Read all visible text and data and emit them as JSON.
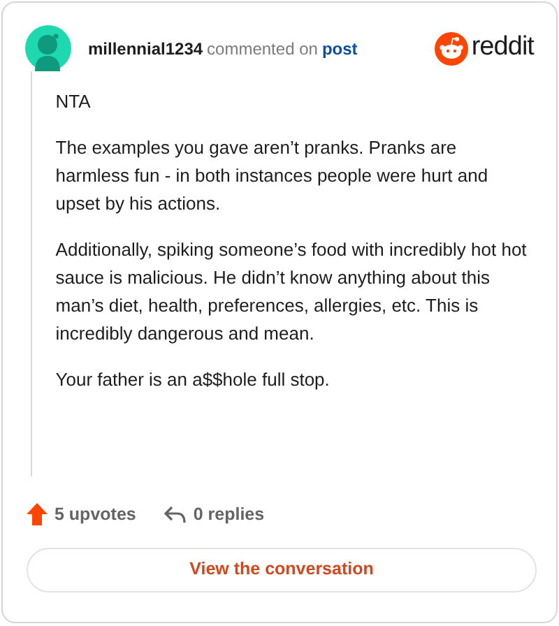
{
  "author": "millennial1234",
  "action": "commented on",
  "target": "post",
  "logo_text": "reddit",
  "paragraphs": [
    "NTA",
    "The examples you gave aren’t pranks. Pranks are harmless fun - in both instances people were hurt and upset by his actions.",
    "Additionally, spiking someone’s food with incredibly hot hot sauce is malicious. He didn’t know anything about this man’s diet, health, preferences, allergies, etc. This is incredibly dangerous and mean.",
    "Your father is an a$$hole full stop."
  ],
  "upvotes": "5 upvotes",
  "replies": "0 replies",
  "button": "View the conversation"
}
